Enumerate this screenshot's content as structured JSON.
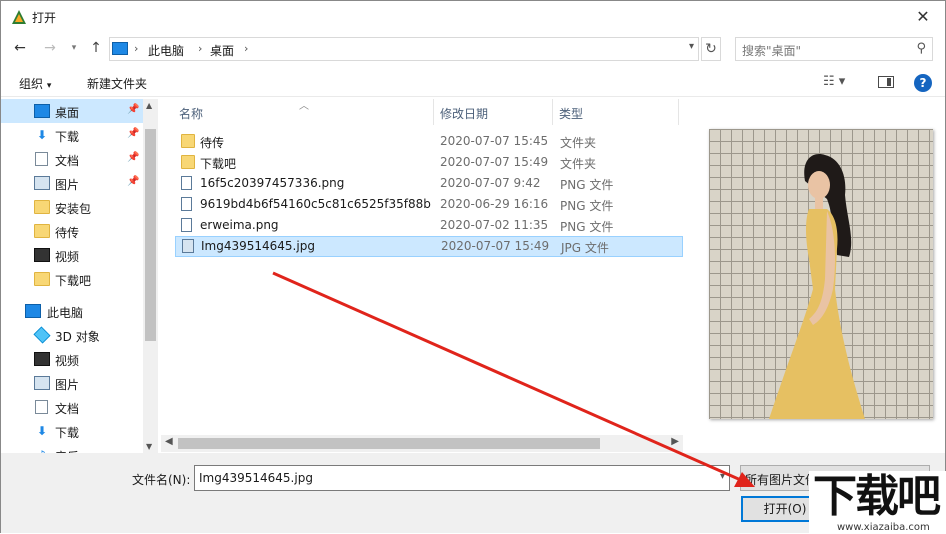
{
  "window": {
    "title": "打开",
    "close_label": "✕"
  },
  "address": {
    "parts": [
      "此电脑",
      "桌面"
    ]
  },
  "search": {
    "placeholder": "搜索\"桌面\""
  },
  "toolbar": {
    "organize": "组织",
    "new_folder": "新建文件夹"
  },
  "nav": {
    "items": [
      {
        "label": "桌面",
        "icon": "desktop-icon",
        "pinned": true
      },
      {
        "label": "下载",
        "icon": "download-icon",
        "pinned": true
      },
      {
        "label": "文档",
        "icon": "document-icon",
        "pinned": true
      },
      {
        "label": "图片",
        "icon": "picture-icon",
        "pinned": true
      },
      {
        "label": "安装包",
        "icon": "folder-icon"
      },
      {
        "label": "待传",
        "icon": "folder-icon"
      },
      {
        "label": "视频",
        "icon": "video-icon"
      },
      {
        "label": "下载吧",
        "icon": "folder-icon"
      },
      {
        "label": "此电脑",
        "icon": "computer-icon"
      },
      {
        "label": "3D 对象",
        "icon": "3d-objects-icon"
      },
      {
        "label": "视频",
        "icon": "video-icon"
      },
      {
        "label": "图片",
        "icon": "picture-icon"
      },
      {
        "label": "文档",
        "icon": "document-icon"
      },
      {
        "label": "下载",
        "icon": "download-icon"
      },
      {
        "label": "音乐",
        "icon": "music-icon"
      }
    ]
  },
  "list": {
    "headers": {
      "name": "名称",
      "date": "修改日期",
      "type": "类型"
    },
    "rows": [
      {
        "name": "待传",
        "date": "2020-07-07 15:45",
        "type": "文件夹",
        "icon": "folder-icon"
      },
      {
        "name": "下载吧",
        "date": "2020-07-07 15:49",
        "type": "文件夹",
        "icon": "folder-icon"
      },
      {
        "name": "16f5c20397457336.png",
        "date": "2020-07-07 9:42",
        "type": "PNG 文件",
        "icon": "image-file-icon"
      },
      {
        "name": "9619bd4b6f54160c5c81c6525f35f88b...",
        "date": "2020-06-29 16:16",
        "type": "PNG 文件",
        "icon": "image-file-icon"
      },
      {
        "name": "erweima.png",
        "date": "2020-07-02 11:35",
        "type": "PNG 文件",
        "icon": "image-file-icon"
      },
      {
        "name": "Img439514645.jpg",
        "date": "2020-07-07 15:49",
        "type": "JPG 文件",
        "icon": "image-file-icon",
        "selected": true
      }
    ]
  },
  "bottom": {
    "filename_label": "文件名(N):",
    "filename_value": "Img439514645.jpg",
    "filetype_value": "所有图片文件 (*.jpeg;*.png;*.jp",
    "open_label": "打开(O)"
  },
  "watermark": {
    "big": "下载吧",
    "small": "www.xiazaiba.com"
  },
  "colors": {
    "selection": "#cce8ff",
    "arrow": "#e0241b",
    "accent": "#0078d7"
  }
}
